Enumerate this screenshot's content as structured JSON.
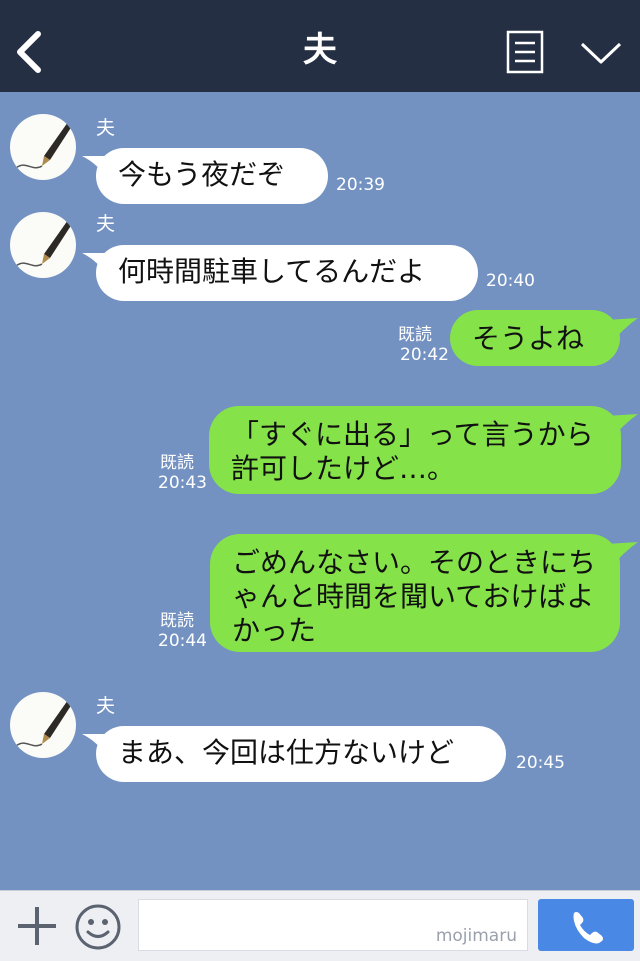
{
  "header": {
    "title": "夫"
  },
  "messages": [
    {
      "side": "in",
      "sender": "夫",
      "text": "今もう夜だぞ",
      "time": "20:39"
    },
    {
      "side": "in",
      "sender": "夫",
      "text": "何時間駐車してるんだよ",
      "time": "20:40"
    },
    {
      "side": "out",
      "read": "既読",
      "text": "そうよね",
      "time": "20:42"
    },
    {
      "side": "out",
      "read": "既読",
      "text": "「すぐに出る」って言うから許可したけど…。",
      "time": "20:43"
    },
    {
      "side": "out",
      "read": "既読",
      "text": "ごめんなさい。そのときにちゃんと時間を聞いておけばよかった",
      "time": "20:44"
    },
    {
      "side": "in",
      "sender": "夫",
      "text": "まあ、今回は仕方ないけど",
      "time": "20:45"
    }
  ],
  "input": {
    "placeholder": "",
    "watermark": "mojimaru"
  },
  "colors": {
    "header": "#252f44",
    "background": "#7392c2",
    "outgoing": "#85e249",
    "incoming": "#ffffff",
    "send": "#4a88e6"
  },
  "icons": [
    "back-chevron-icon",
    "menu-icon",
    "chevron-down-icon",
    "plus-icon",
    "emoji-icon",
    "phone-icon",
    "pen-avatar-icon"
  ]
}
